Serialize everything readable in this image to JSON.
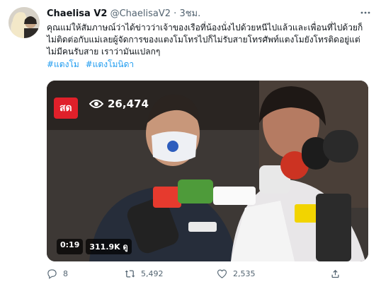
{
  "tweet": {
    "display_name": "Chaelisa V2",
    "handle": "@ChaelisaV2",
    "separator": "·",
    "time": "3ชม.",
    "body": "คุณแม่ให้สัมภาษณ์ว่าได้ข่าวว่าเจ้าของเรือที่น้องนั่งไปด้วยหนีไปแล้วและเพื่อนที่ไปด้วยก็ไม่ติดต่อกับแม่เลยผู้จัดการของแตงโมโทรไปก็ไม่รับสายโทรศัพท์แตงโมยังโทรติดอยู่แต่ไม่มีคนรับสาย  เราว่ามันแปลกๆ",
    "hashtags": [
      "#แตงโม",
      "#แตงโมนิดา"
    ]
  },
  "media": {
    "live_label": "สด",
    "viewer_count": "26,474",
    "duration": "0:19",
    "views": "311.9K ดู"
  },
  "actions": {
    "reply_count": "8",
    "retweet_count": "5,492",
    "like_count": "2,535"
  },
  "icons": [
    "more-icon",
    "eye-icon",
    "reply-icon",
    "retweet-icon",
    "like-icon",
    "share-icon"
  ],
  "colors": {
    "link": "#1d9bf0",
    "live": "#e0202a",
    "muted": "#536471"
  }
}
